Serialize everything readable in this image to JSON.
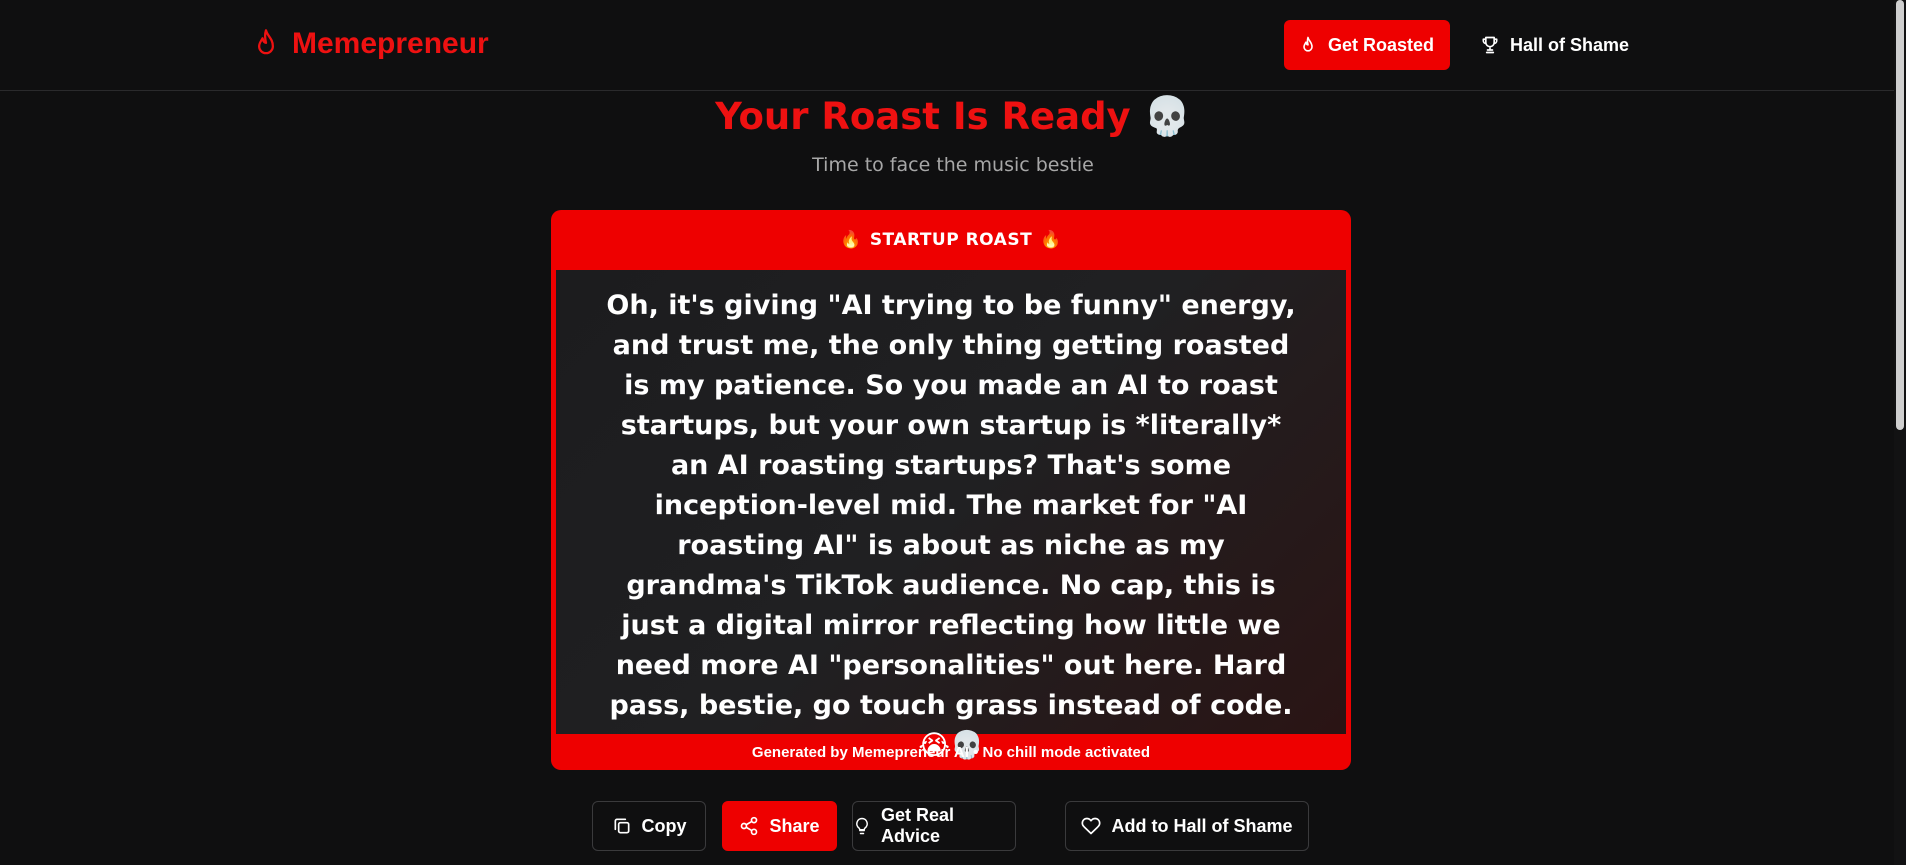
{
  "header": {
    "brand_name": "Memepreneur",
    "get_roasted_label": "Get Roasted",
    "hall_of_shame_label": "Hall of Shame"
  },
  "hero": {
    "title": "Your Roast Is Ready",
    "title_emoji": "💀",
    "subtitle": "Time to face the music bestie"
  },
  "roast_card": {
    "header_icon": "🔥",
    "header_label": "STARTUP ROAST",
    "body": "Oh, it's giving \"AI trying to be funny\" energy, and trust me, the only thing getting roasted is my patience. So you made an AI to roast startups, but your own startup is *literally* an AI roasting startups? That's some inception-level mid. The market for \"AI roasting AI\" is about as niche as my grandma's TikTok audience. No cap, this is just a digital mirror reflecting how little we need more AI \"personalities\" out here. Hard pass, bestie, go touch grass instead of code. 😭💀",
    "footer": "Generated by Memepreneur AI • No chill mode activated"
  },
  "actions": {
    "copy_label": "Copy",
    "share_label": "Share",
    "advice_label": "Get Real Advice",
    "hall_label": "Add to Hall of Shame"
  },
  "colors": {
    "accent": "#ee0000",
    "background": "#0f0f10",
    "muted_text": "#a7a7a7"
  },
  "icons": {
    "brand": "flame-icon",
    "get_roasted": "flame-icon",
    "hall_of_shame": "trophy-icon",
    "copy": "copy-icon",
    "share": "share-icon",
    "advice": "lightbulb-icon",
    "add_hall": "heart-icon"
  }
}
